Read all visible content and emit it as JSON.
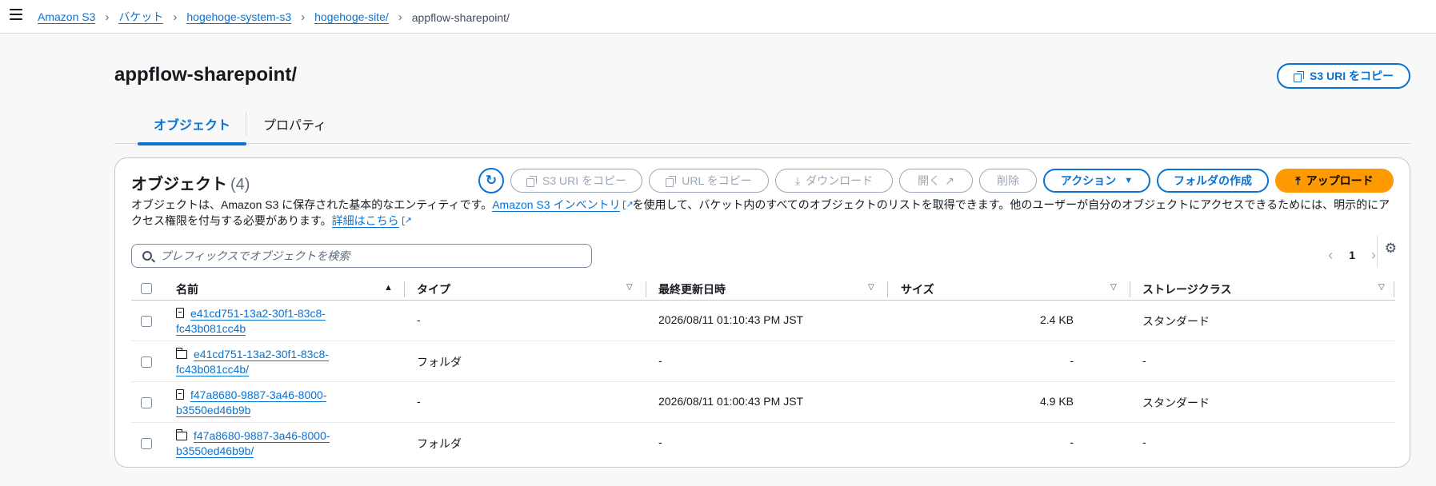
{
  "breadcrumb": [
    {
      "label": "Amazon S3"
    },
    {
      "label": "バケット"
    },
    {
      "label": "hogehoge-system-s3"
    },
    {
      "label": "hogehoge-site/"
    }
  ],
  "breadcrumb_current": "appflow-sharepoint/",
  "page_title": "appflow-sharepoint/",
  "header_copy_label": "S3 URI をコピー",
  "tabs": [
    {
      "label": "オブジェクト"
    },
    {
      "label": "プロパティ"
    }
  ],
  "panel": {
    "title": "オブジェクト",
    "count": "(4)",
    "desc_part1": "オブジェクトは、Amazon S3 に保存された基本的なエンティティです。",
    "desc_link1": "Amazon S3 インベントリ",
    "desc_part2": "を使用して、バケット内のすべてのオブジェクトのリストを取得できます。他のユーザーが自分のオブジェクトにアクセスできるためには、明示的にアクセス権限を付与する必要があります。",
    "desc_link2": "詳細はこちら"
  },
  "toolbar": {
    "copy_s3_uri": "S3 URI をコピー",
    "copy_url": "URL をコピー",
    "download": "ダウンロード",
    "open": "開く",
    "delete": "削除",
    "actions": "アクション",
    "create_folder": "フォルダの作成",
    "upload": "アップロード"
  },
  "search": {
    "placeholder": "プレフィックスでオブジェクトを検索"
  },
  "pagination": {
    "page": "1"
  },
  "table": {
    "headers": {
      "name": "名前",
      "type": "タイプ",
      "modified": "最終更新日時",
      "size": "サイズ",
      "storage": "ストレージクラス"
    },
    "rows": [
      {
        "name_line1": "e41cd751-13a2-30f1-83c8-",
        "name_line2": "fc43b081cc4b",
        "kind": "file",
        "type": "-",
        "modified": "2026/08/11 01:10:43 PM JST",
        "size": "2.4 KB",
        "storage": "スタンダード"
      },
      {
        "name_line1": "e41cd751-13a2-30f1-83c8-",
        "name_line2": "fc43b081cc4b/",
        "kind": "folder",
        "type": "フォルダ",
        "modified": "-",
        "size": "-",
        "storage": "-"
      },
      {
        "name_line1": "f47a8680-9887-3a46-8000-",
        "name_line2": "b3550ed46b9b",
        "kind": "file",
        "type": "-",
        "modified": "2026/08/11 01:00:43 PM JST",
        "size": "4.9 KB",
        "storage": "スタンダード"
      },
      {
        "name_line1": "f47a8680-9887-3a46-8000-",
        "name_line2": "b3550ed46b9b/",
        "kind": "folder",
        "type": "フォルダ",
        "modified": "-",
        "size": "-",
        "storage": "-"
      }
    ]
  },
  "colors": {
    "link": "#0972d3",
    "primary": "#ff9900",
    "disabled": "#9ba7b6"
  },
  "icons": [
    "menu-icon",
    "copy-icon",
    "refresh-icon",
    "download-icon",
    "external-link-icon",
    "caret-down-icon",
    "upload-icon",
    "search-icon",
    "chevron-left-icon",
    "chevron-right-icon",
    "gear-icon",
    "file-icon",
    "folder-icon",
    "sort-asc-icon",
    "sort-desc-icon"
  ]
}
